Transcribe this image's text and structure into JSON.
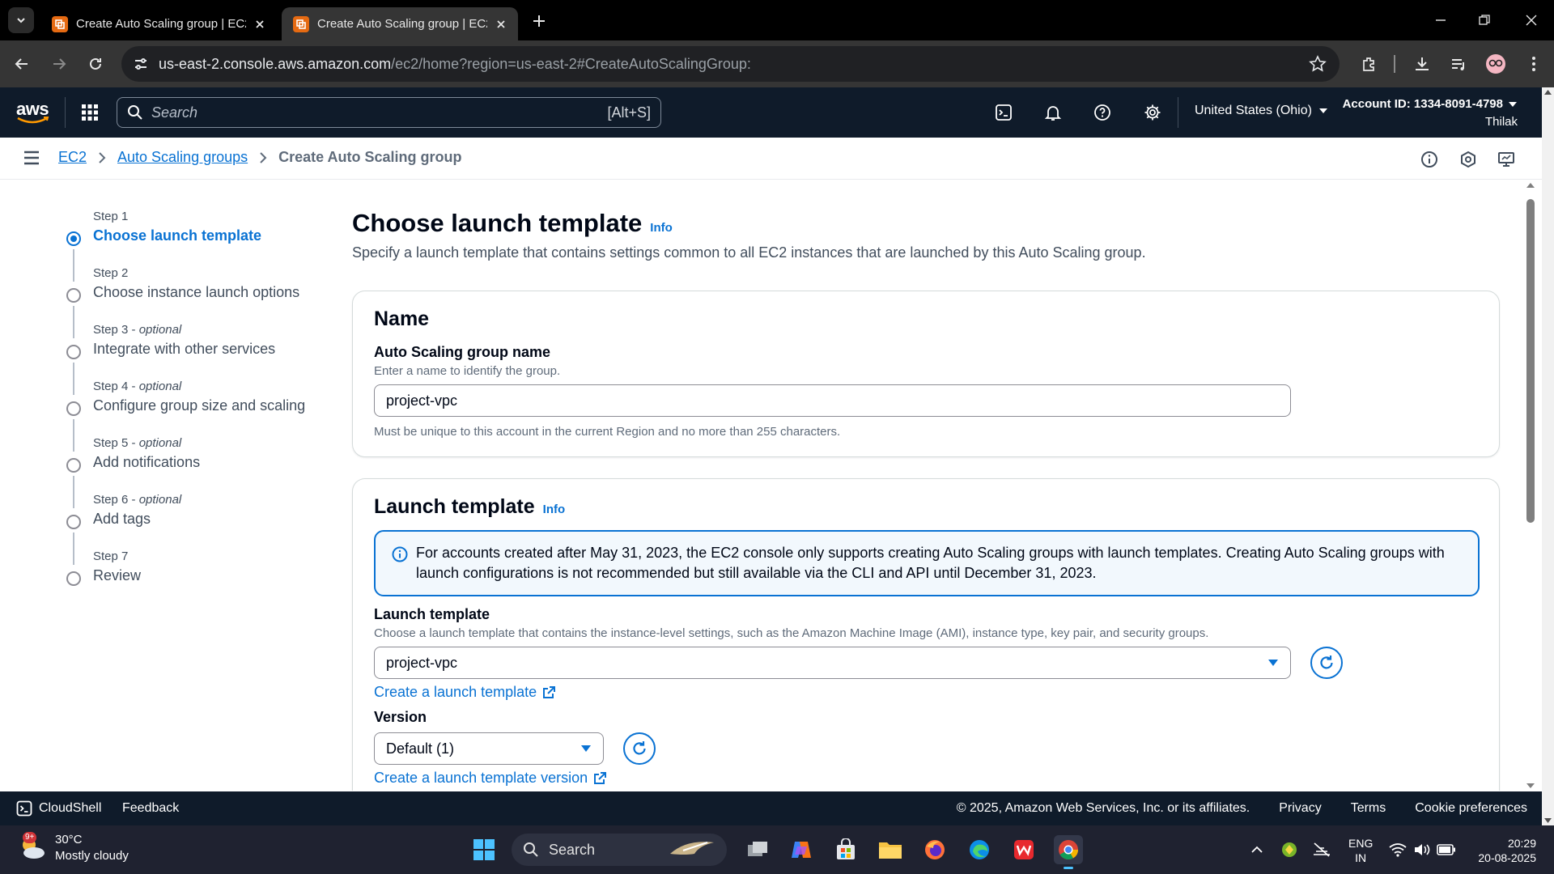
{
  "browser": {
    "tabs": [
      {
        "title": "Create Auto Scaling group | EC2 | us-east-2",
        "active": false
      },
      {
        "title": "Create Auto Scaling group | EC2 | us-east-2",
        "active": true
      }
    ],
    "url_host": "us-east-2.console.aws.amazon.com",
    "url_path": "/ec2/home?region=us-east-2#CreateAutoScalingGroup:"
  },
  "aws_nav": {
    "logo": "aws",
    "search_placeholder": "Search",
    "search_shortcut": "[Alt+S]",
    "region": "United States (Ohio)",
    "account": "Account ID: 1334-8091-4798",
    "user": "Thilak"
  },
  "breadcrumb": {
    "items": [
      "EC2",
      "Auto Scaling groups"
    ],
    "current": "Create Auto Scaling group"
  },
  "steps": [
    {
      "label": "Step 1",
      "optional": "",
      "name": "Choose launch template",
      "active": true
    },
    {
      "label": "Step 2",
      "optional": "",
      "name": "Choose instance launch options",
      "active": false
    },
    {
      "label": "Step 3 - ",
      "optional": "optional",
      "name": "Integrate with other services",
      "active": false
    },
    {
      "label": "Step 4 - ",
      "optional": "optional",
      "name": "Configure group size and scaling",
      "active": false
    },
    {
      "label": "Step 5 - ",
      "optional": "optional",
      "name": "Add notifications",
      "active": false
    },
    {
      "label": "Step 6 - ",
      "optional": "optional",
      "name": "Add tags",
      "active": false
    },
    {
      "label": "Step 7",
      "optional": "",
      "name": "Review",
      "active": false
    }
  ],
  "main": {
    "title": "Choose launch template",
    "info": "Info",
    "description": "Specify a launch template that contains settings common to all EC2 instances that are launched by this Auto Scaling group.",
    "name_card": {
      "heading": "Name",
      "field_label": "Auto Scaling group name",
      "field_desc": "Enter a name to identify the group.",
      "field_value": "project-vpc",
      "field_hint": "Must be unique to this account in the current Region and no more than 255 characters."
    },
    "template_card": {
      "heading": "Launch template",
      "info": "Info",
      "alert": "For accounts created after May 31, 2023, the EC2 console only supports creating Auto Scaling groups with launch templates. Creating Auto Scaling groups with launch configurations is not recommended but still available via the CLI and API until December 31, 2023.",
      "lt_label": "Launch template",
      "lt_desc": "Choose a launch template that contains the instance-level settings, such as the Amazon Machine Image (AMI), instance type, key pair, and security groups.",
      "lt_value": "project-vpc",
      "create_lt_link": "Create a launch template",
      "version_label": "Version",
      "version_value": "Default (1)",
      "create_version_link": "Create a launch template version"
    }
  },
  "footer": {
    "cloudshell": "CloudShell",
    "feedback": "Feedback",
    "copyright": "© 2025, Amazon Web Services, Inc. or its affiliates.",
    "privacy": "Privacy",
    "terms": "Terms",
    "cookies": "Cookie preferences"
  },
  "taskbar": {
    "temp": "30°C",
    "weather": "Mostly cloudy",
    "weather_badge": "9+",
    "search": "Search",
    "lang1": "ENG",
    "lang2": "IN",
    "time": "20:29",
    "date": "20-08-2025"
  },
  "colors": {
    "aws_nav_bg": "#0f1b2a",
    "accent_blue": "#0972d3",
    "alert_bg": "#f2f8fd"
  }
}
